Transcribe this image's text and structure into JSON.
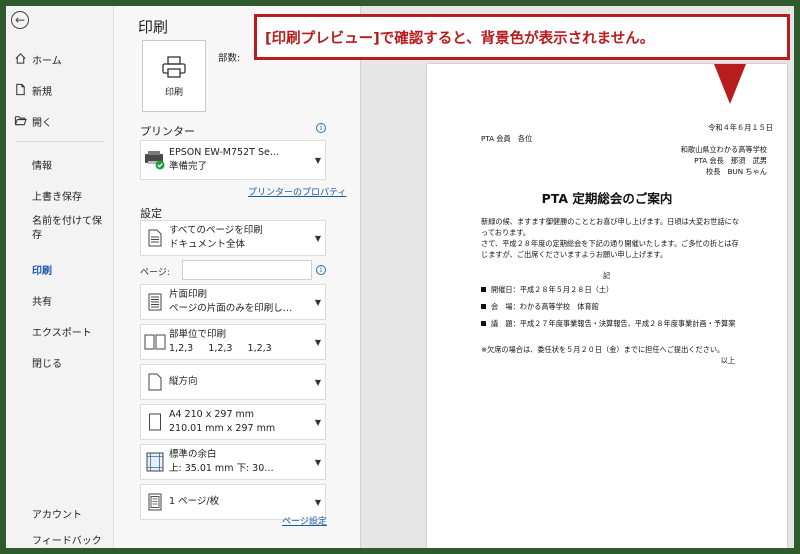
{
  "nav": {
    "back_glyph": "←",
    "items": [
      {
        "label": "ホーム"
      },
      {
        "label": "新規"
      },
      {
        "label": "開く"
      },
      {
        "label": "情報"
      },
      {
        "label": "上書き保存"
      },
      {
        "label": "名前を付けて保存"
      },
      {
        "label": "印刷"
      },
      {
        "label": "共有"
      },
      {
        "label": "エクスポート"
      },
      {
        "label": "閉じる"
      },
      {
        "label": "アカウント"
      },
      {
        "label": "フィードバック"
      }
    ],
    "active": "印刷"
  },
  "settings": {
    "title": "印刷",
    "print_button": "印刷",
    "copies_label": "部数:",
    "printer_section": "プリンター",
    "printer_name": "EPSON EW-M752T Se…",
    "printer_status": "準備完了",
    "printer_properties": "プリンターのプロパティ",
    "settings_section": "設定",
    "dropdowns": [
      {
        "line1": "すべてのページを印刷",
        "line2": "ドキュメント全体"
      },
      {
        "line1": "片面印刷",
        "line2": "ページの片面のみを印刷し…"
      },
      {
        "line1": "部単位で印刷",
        "line2": "1,2,3     1,2,3     1,2,3"
      },
      {
        "line1": "縦方向",
        "line2": ""
      },
      {
        "line1": "A4 210 x 297 mm",
        "line2": "210.01 mm x 297 mm"
      },
      {
        "line1": "標準の余白",
        "line2": "上: 35.01 mm 下: 30…"
      },
      {
        "line1": "1 ページ/枚",
        "line2": ""
      }
    ],
    "pages_label": "ページ:",
    "pages_value": "",
    "page_setup": "ページ設定",
    "info_glyph": "i"
  },
  "preview": {
    "date": "令和４年６月１５日",
    "recipient": "PTA 会員　各位",
    "sender1": "和歌山県立わかる高等学校",
    "sender2": "PTA 会長　那須　武男",
    "sender3": "校長　BUN ちゃん",
    "title": "PTA 定期総会のご案内",
    "body1": "新緑の候、ますます御健勝のこととお喜び申し上げます。日頃は大変お世話にな",
    "body2": "っております。",
    "body3": "さて、平成２８年度の定期総会を下記の通り開催いたします。ご多忙の折とは存",
    "body4": "じますが、ご出席くださいますようお願い申し上げます。",
    "ki": "記",
    "item1": "開催日：平成２８年５月２８日（土）",
    "item2": "会　場：わかる高等学校　体育館",
    "item3": "議　題：平成２７年度事業報告・決算報告、平成２８年度事業計画・予算案",
    "note": "※欠席の場合は、委任状を５月２０日（金）までに担任へご提出ください。",
    "ijou": "以上"
  },
  "callout": {
    "text": "[印刷プレビュー]で確認すると、背景色が表示されません。"
  },
  "colors": {
    "accent": "#1d5aa8",
    "callout": "#b81c1c",
    "frame": "#2e5a2e"
  }
}
